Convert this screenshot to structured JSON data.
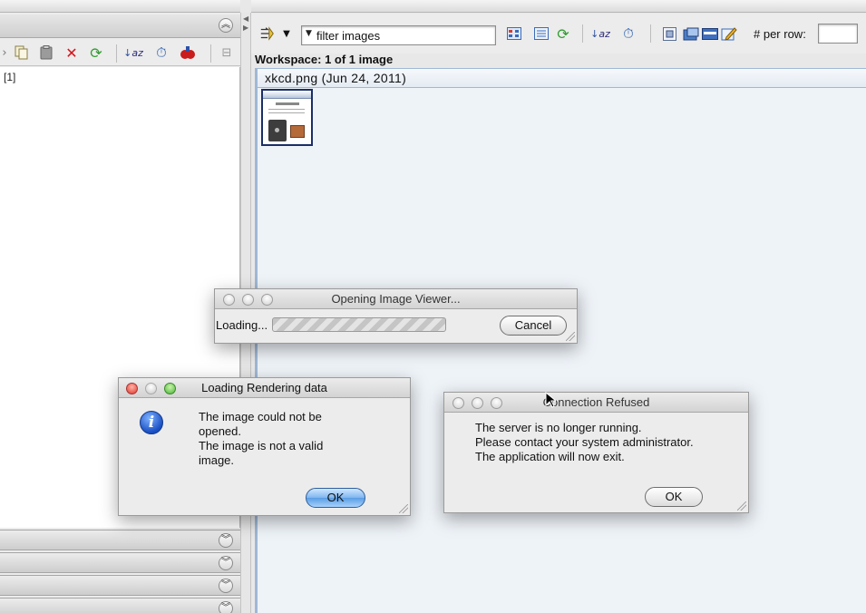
{
  "left_panel": {
    "tree_item": "[1]",
    "accordion_count": 4
  },
  "right_panel": {
    "filter": {
      "value": "filter  images"
    },
    "per_row_label": "# per row:",
    "per_row_value": "",
    "workspace_label": "Workspace: 1 of 1 image",
    "group_title": "xkcd.png (Jun 24, 2011)"
  },
  "dialogs": {
    "image_viewer": {
      "title": "Opening Image Viewer...",
      "loading_label": "Loading...",
      "cancel_label": "Cancel"
    },
    "rendering": {
      "title": "Loading Rendering data",
      "message_lines": [
        "The image could not be",
        "opened.",
        "The image is not a valid",
        "image."
      ],
      "ok_label": "OK"
    },
    "connection": {
      "title": "Connection Refused",
      "message_lines": [
        "The server is no longer running.",
        "Please contact your system administrator.",
        "The application will now exit."
      ],
      "ok_label": "OK"
    }
  },
  "colors": {
    "workspace_bg": "#eef3f8",
    "workspace_border": "#9fb8d6",
    "default_button": "#5a9de4",
    "close_red": "#e0372a",
    "zoom_green": "#4ab53a"
  },
  "icons": {
    "left_toolbar": [
      "copy-icon",
      "paste-icon",
      "delete-icon",
      "refresh-icon",
      "sort-alpha-icon",
      "timer-icon",
      "tag-icon",
      "collapse-all-icon"
    ],
    "right_toolbar": [
      "view-mode-icon",
      "thumbnail-grid-icon",
      "list-view-icon",
      "refresh-icon",
      "sort-alpha-icon",
      "timer-icon",
      "zoom-fit-icon",
      "folder-icon",
      "save-icon",
      "edit-icon"
    ]
  }
}
